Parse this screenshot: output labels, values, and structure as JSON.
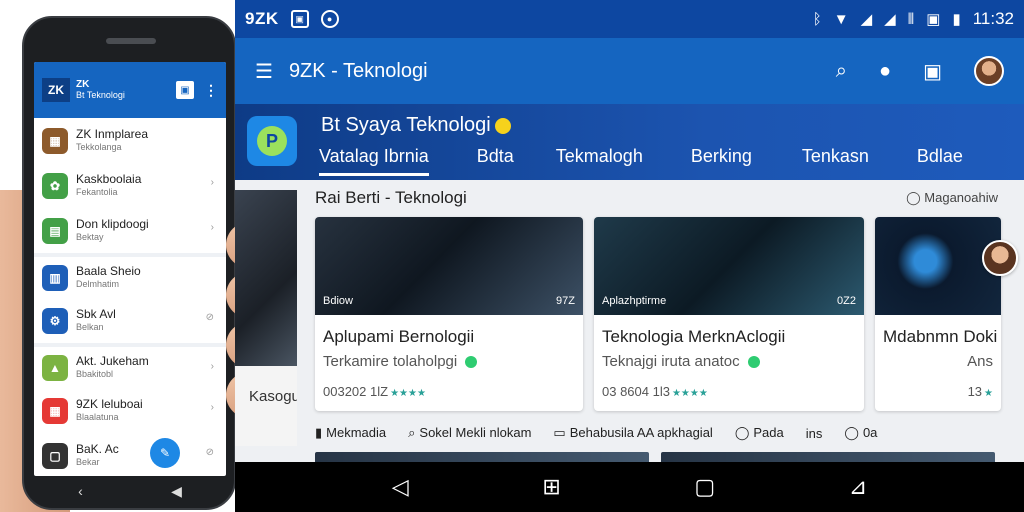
{
  "phone": {
    "brand_line1": "ZK",
    "brand_line2": "Bt Teknologi",
    "logo": "ZK",
    "items": [
      {
        "title": "ZK Inmplarea",
        "sub": "Tekkolanga",
        "icon": "app-icon",
        "color": "#8d5a2b"
      },
      {
        "title": "Kaskboolaia",
        "sub": "Fekantolia",
        "icon": "app-icon",
        "color": "#43a047"
      },
      {
        "title": "Don klipdoogi",
        "sub": "Bektay",
        "icon": "sheet-icon",
        "color": "#43a047"
      },
      {
        "title": "Baala Sheio",
        "sub": "Delmhatim",
        "icon": "calendar-icon",
        "color": "#1e5fb8"
      },
      {
        "title": "Sbk Avl",
        "sub": "Belkan",
        "icon": "gear-icon",
        "color": "#1e5fb8"
      },
      {
        "title": "Akt. Jukeham",
        "sub": "Bbakitobl",
        "icon": "android-icon",
        "color": "#7cb342"
      },
      {
        "title": "9ZK leluboai",
        "sub": "Blaalatuna",
        "icon": "grid-icon",
        "color": "#e53935"
      },
      {
        "title": "BaK. Ac",
        "sub": "Bekar",
        "icon": "square-icon",
        "color": "#333333"
      }
    ]
  },
  "status": {
    "left": "9ZK",
    "time": "11:32"
  },
  "appbar": {
    "title": "9ZK - Teknologi"
  },
  "hero": {
    "title": "Bt Syaya Teknologi",
    "tabs": [
      "Vatalag Ibrnia",
      "Bdta",
      "Tekmalogh",
      "Berking",
      "Tenkasn",
      "Bdlae"
    ]
  },
  "section": {
    "left_peek_text": "Kasogu",
    "title": "Rai Berti - Teknologi",
    "more": "Maganoahiw"
  },
  "cards": [
    {
      "title": "Aplupami Bernologii",
      "sub": "Terkamire  tolaholpgi",
      "tag": "Bdiow",
      "stat": "97Z",
      "meta": "003202  1lZ"
    },
    {
      "title": "Teknologia  MerknAclogii",
      "sub": "Teknajgi  iruta  anatoc",
      "tag": "Aplazhptirme",
      "stat": "0Z2",
      "meta": "03 8604  1l3"
    },
    {
      "title": "Mdabnmn Doki",
      "sub": "Ans",
      "tag": "",
      "stat": "",
      "meta": "13"
    }
  ],
  "chips": [
    {
      "icon": "bookmark-icon",
      "label": "Mekmadia"
    },
    {
      "icon": "search-icon",
      "label": "Sokel Mekli nlokam"
    },
    {
      "icon": "message-icon",
      "label": "Behabusila AA apkhagial"
    },
    {
      "icon": "chat-icon",
      "label": "Pada"
    },
    {
      "icon": "text-icon",
      "label": "ins"
    },
    {
      "icon": "chat-icon",
      "label": "0a"
    }
  ],
  "colors": {
    "status_bar": "#0d47a1",
    "app_bar": "#1565c0",
    "accent": "#1e88e5",
    "rating": "#2aa198"
  }
}
